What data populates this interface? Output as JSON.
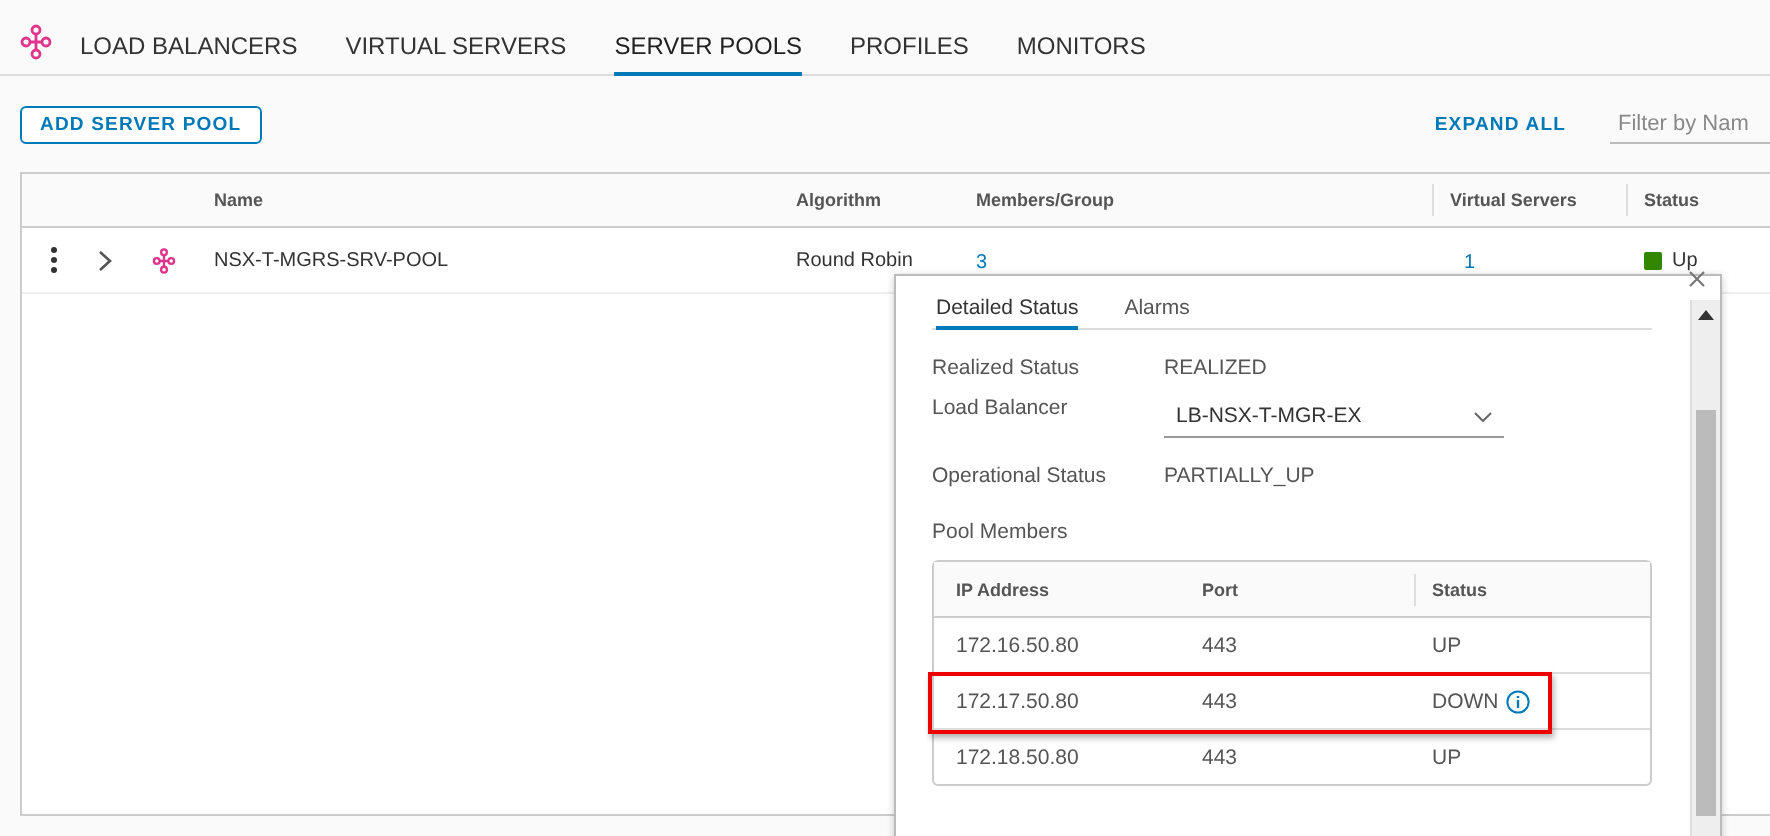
{
  "tabs": [
    {
      "label": "LOAD BALANCERS",
      "selected": false
    },
    {
      "label": "VIRTUAL SERVERS",
      "selected": false
    },
    {
      "label": "SERVER POOLS",
      "selected": true
    },
    {
      "label": "PROFILES",
      "selected": false
    },
    {
      "label": "MONITORS",
      "selected": false
    }
  ],
  "toolbar": {
    "add_button": "ADD SERVER POOL",
    "expand_link": "EXPAND ALL",
    "filter": {
      "placeholder": "Filter by Nam"
    }
  },
  "table": {
    "columns": [
      "Name",
      "Algorithm",
      "Members/Group",
      "Virtual Servers",
      "Status"
    ],
    "rows": [
      {
        "name": "NSX-T-MGRS-SRV-POOL",
        "algorithm": "Round Robin",
        "members": "3",
        "virtual_servers": "1",
        "status": "Up",
        "color": "#318700"
      }
    ]
  },
  "popup": {
    "tabs": [
      {
        "label": "Detailed Status",
        "selected": true
      },
      {
        "label": "Alarms",
        "selected": false
      }
    ],
    "fields": [
      {
        "kind": "text",
        "label": "Realized Status",
        "value": "REALIZED"
      },
      {
        "kind": "select",
        "label": "Load Balancer",
        "value": "LB-NSX-T-MGR-EX"
      },
      {
        "kind": "text",
        "label": "Operational Status",
        "value": "PARTIALLY_UP"
      }
    ],
    "members_title": "Pool Members",
    "members_columns": [
      "IP Address",
      "Port",
      "Status"
    ],
    "members": [
      {
        "ip": "172.16.50.80",
        "port": "443",
        "status": "UP",
        "info": false,
        "highlighted": false
      },
      {
        "ip": "172.17.50.80",
        "port": "443",
        "status": "DOWN",
        "info": true,
        "highlighted": true
      },
      {
        "ip": "172.18.50.80",
        "port": "443",
        "status": "UP",
        "info": false,
        "highlighted": false
      }
    ]
  }
}
